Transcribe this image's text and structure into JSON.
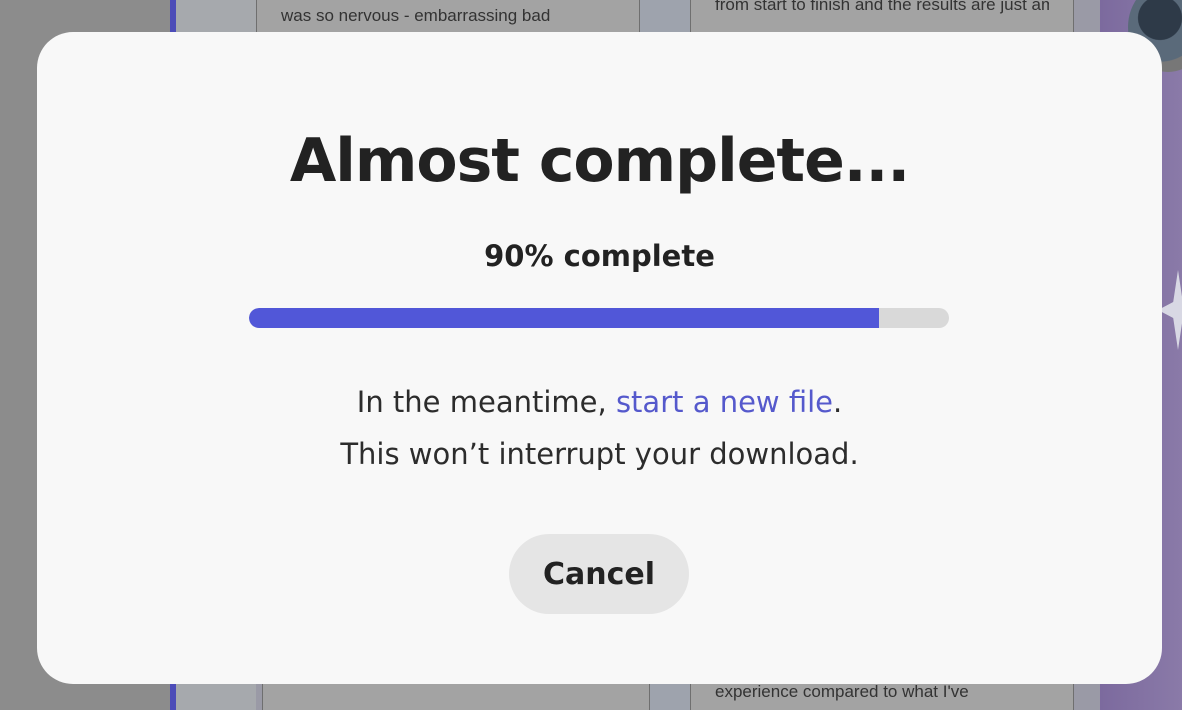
{
  "background": {
    "card_top_left_text": "was so nervous - embarrassing bad",
    "card_top_right_text": "from start to finish and the results are just amazing, thank you for making",
    "card_bottom_right_text": "experience compared to what I've"
  },
  "modal": {
    "title": "Almost complete...",
    "progress": {
      "label": "90% complete",
      "fraction": 0.9,
      "fill_color": "#5157d8",
      "track_color": "#d9d9d9"
    },
    "message": {
      "prefix": "In the meantime, ",
      "link_text": "start a new file",
      "suffix": ".",
      "line2": "This won’t interrupt your download."
    },
    "cancel_label": "Cancel"
  },
  "colors": {
    "accent": "#5157d8",
    "link": "#5559cc",
    "modal_bg": "#f8f8f8",
    "overlay": "#8a8a8a"
  }
}
